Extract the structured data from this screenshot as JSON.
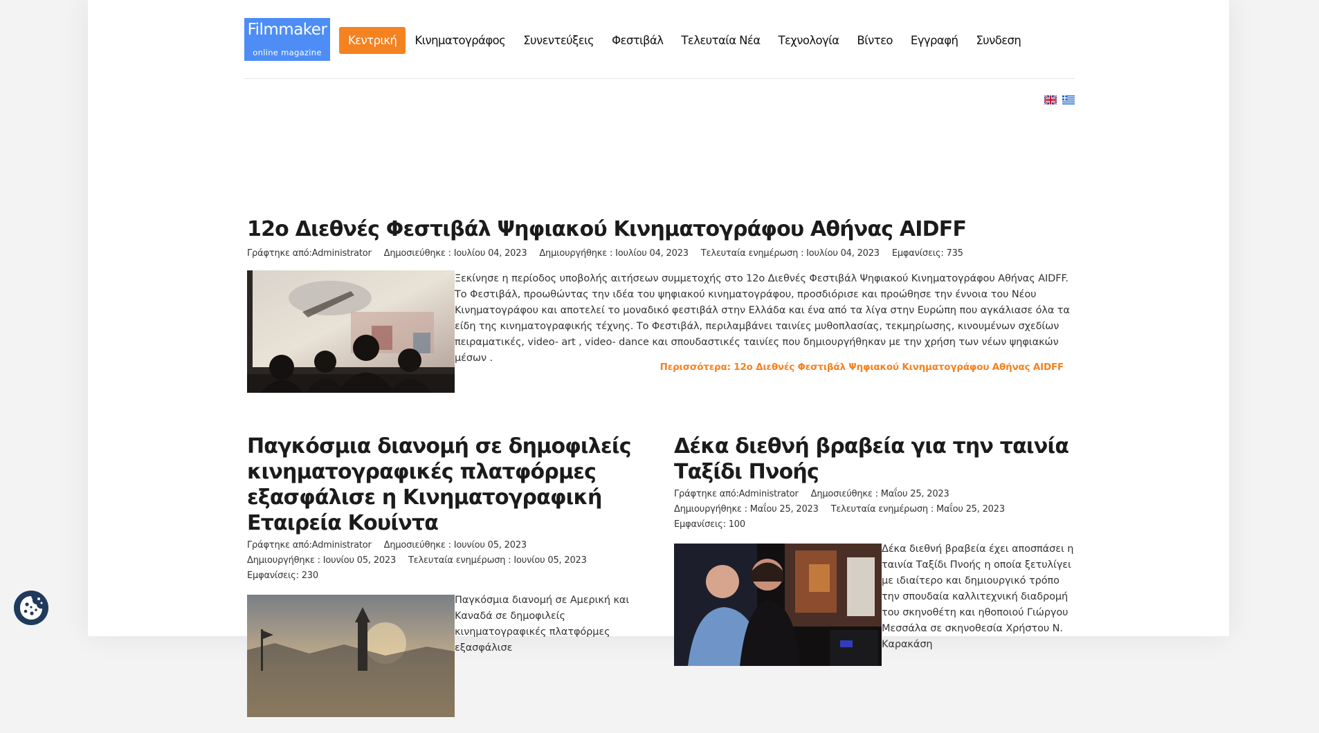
{
  "header": {
    "logo_title": "Filmmaker",
    "logo_subtitle": "online magazine",
    "nav": [
      "Κεντρική",
      "Κινηματογράφος",
      "Συνεντεύξεις",
      "Φεστιβάλ",
      "Τελευταία Νέα",
      "Τεχνολογία",
      "Βίντεο",
      "Εγγραφή",
      "Συνδεση"
    ],
    "active_nav": "Κεντρική",
    "accent_color": "#f58220",
    "logo_color": "#4d8df5"
  },
  "languages": [
    "en-flag-icon",
    "el-flag-icon"
  ],
  "featured": {
    "title": "12ο Διεθνές Φεστιβάλ Ψηφιακού Κινηματογράφου Αθήνας AIDFF",
    "author": "Γράφτηκε από:Administrator",
    "published": "Δημοσιεύθηκε : Ιουλίου 04, 2023",
    "created": "Δημιουργήθηκε : Ιουλίου 04, 2023",
    "updated": "Τελευταία ενημέρωση : Ιουλίου 04, 2023",
    "hits": "Εμφανίσεις: 735",
    "intro": "Ξεκίνησε η περίοδος υποβολής αιτήσεων συμμετοχής στο 12ο Διεθνές Φεστιβάλ Ψηφιακού Κινηματογράφου Αθήνας AIDFF. Το Φεστιβάλ, προωθώντας την ιδέα του ψηφιακού κινηματογράφου, προσδιόρισε και προώθησε την έννοια του Νέου Κινηματογράφου και αποτελεί το μοναδικό φεστιβάλ στην Ελλάδα και ένα από τα λίγα στην Ευρώπη που αγκάλιασε όλα τα είδη της κινηματογραφικής τέχνης. Το Φεστιβάλ, περιλαμβάνει ταινίες μυθοπλασίας, τεκμηρίωσης, κινουμένων σχεδίων πειραματικές, video- art , video- dance και σπουδαστικές ταινίες που δημιουργήθηκαν με την χρήση των νέων ψηφιακών μέσων .",
    "readmore": "Περισσότερα: 12ο Διεθνές Φεστιβάλ Ψηφιακού Κινηματογράφου Αθήνας AIDFF"
  },
  "articles": [
    {
      "title": "Παγκόσμια διανομή σε δημοφιλείς κινηματογραφικές πλατφόρμες εξασφάλισε η Κινηματογραφική Εταιρεία Κουίντα",
      "author": "Γράφτηκε από:Administrator",
      "published": "Δημοσιεύθηκε : Ιουνίου 05, 2023",
      "created": "Δημιουργήθηκε : Ιουνίου 05, 2023",
      "updated": "Τελευταία ενημέρωση : Ιουνίου 05, 2023",
      "hits": "Εμφανίσεις: 230",
      "intro": "Παγκόσμια διανομή σε Αμερική και Καναδά σε δημοφιλείς κινηματογραφικές πλατφόρμες εξασφάλισε"
    },
    {
      "title": "Δέκα διεθνή βραβεία για την ταινία Ταξίδι Πνοής",
      "author": "Γράφτηκε από:Administrator",
      "published": "Δημοσιεύθηκε : Μαΐου 25, 2023",
      "created": "Δημιουργήθηκε : Μαΐου 25, 2023",
      "updated": "Τελευταία ενημέρωση : Μαΐου 25, 2023",
      "hits": "Εμφανίσεις: 100",
      "intro": "Δέκα διεθνή βραβεία έχει αποσπάσει η ταινία Ταξίδι Πνοής η οποία ξετυλίγει με ιδιαίτερο και δημιουργικό τρόπο την σπουδαία καλλιτεχνική διαδρομή του σκηνοθέτη και ηθοποιού Γιώργου Μεσσάλα σε σκηνοθεσία Χρήστου Ν. Καρακάση"
    }
  ],
  "cookie_button": "cookie-icon"
}
